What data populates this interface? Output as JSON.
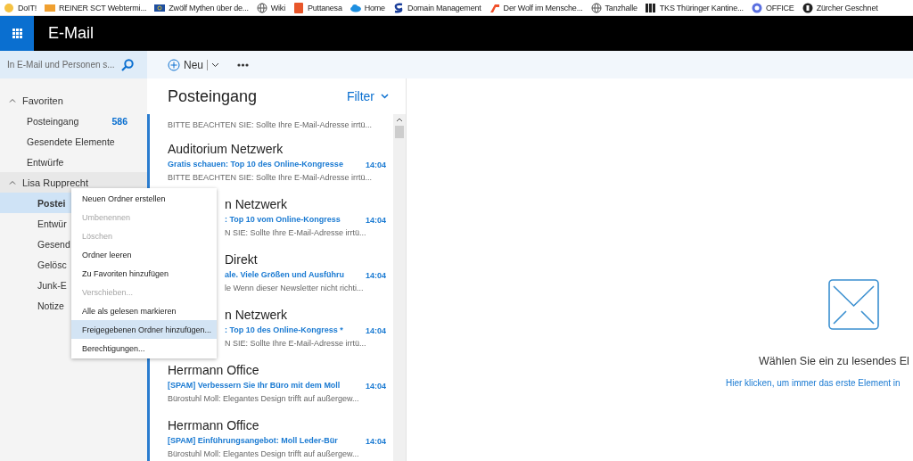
{
  "bookmarks": [
    {
      "label": "DoIT!"
    },
    {
      "label": "REINER SCT Webtermi..."
    },
    {
      "label": "Zwölf Mythen über de..."
    },
    {
      "label": "Wiki"
    },
    {
      "label": "Puttanesa"
    },
    {
      "label": "Home"
    },
    {
      "label": "Domain Management"
    },
    {
      "label": "Der Wolf im Mensche..."
    },
    {
      "label": "Tanzhalle"
    },
    {
      "label": "TKS Thüringer Kantine..."
    },
    {
      "label": "OFFICE"
    },
    {
      "label": "Zürcher Geschnet"
    }
  ],
  "app_bar": {
    "title": "E-Mail"
  },
  "search": {
    "placeholder": "In E-Mail und Personen s..."
  },
  "toolbar": {
    "new_label": "Neu"
  },
  "sidebar": {
    "groups": [
      {
        "label": "Favoriten",
        "expanded": true,
        "items": [
          {
            "label": "Posteingang",
            "count": "586",
            "selected": false
          },
          {
            "label": "Gesendete Elemente",
            "selected": false
          },
          {
            "label": "Entwürfe",
            "selected": false
          }
        ]
      },
      {
        "label": "Lisa Rupprecht",
        "expanded": true,
        "items": [
          {
            "label": "Postei",
            "selected": true
          },
          {
            "label": "Entwür",
            "selected": false
          },
          {
            "label": "Gesend",
            "selected": false
          },
          {
            "label": "Gelösc",
            "selected": false
          },
          {
            "label": "Junk-E",
            "selected": false
          },
          {
            "label": "Notize",
            "selected": false
          }
        ]
      }
    ]
  },
  "message_list": {
    "title": "Posteingang",
    "filter": "Filter",
    "messages": [
      {
        "kind": "partial",
        "unread": true,
        "preview": "BITTE BEACHTEN SIE: Sollte Ihre E-Mail-Adresse irrtü..."
      },
      {
        "kind": "full",
        "unread": true,
        "sender": "Auditorium Netzwerk",
        "subject": "Gratis schauen: Top 10 des Online-Kongresse",
        "time": "14:04",
        "preview": "BITTE BEACHTEN SIE: Sollte Ihre E-Mail-Adresse irrtü..."
      },
      {
        "kind": "covered",
        "unread": true,
        "sender": "n Netzwerk",
        "subject": ": Top 10 vom Online-Kongress",
        "time": "14:04",
        "preview": "N SIE: Sollte Ihre E-Mail-Adresse irrtü..."
      },
      {
        "kind": "covered",
        "unread": true,
        "sender": "Direkt",
        "subject": "ale. Viele Größen und Ausführu",
        "time": "14:04",
        "preview": "le Wenn dieser Newsletter nicht richti..."
      },
      {
        "kind": "covered",
        "unread": true,
        "sender": "n Netzwerk",
        "subject": ": Top 10 des Online-Kongress *",
        "time": "14:04",
        "preview": "N SIE: Sollte Ihre E-Mail-Adresse irrtü..."
      },
      {
        "kind": "full",
        "unread": true,
        "sender": "Herrmann Office",
        "subject": "[SPAM] Verbessern Sie Ihr Büro mit dem Moll",
        "time": "14:04",
        "preview": "Bürostuhl Moll: Elegantes Design trifft auf außergew..."
      },
      {
        "kind": "full",
        "unread": true,
        "sender": "Herrmann Office",
        "subject": "[SPAM] Einführungsangebot: Moll Leder-Bür",
        "time": "14:04",
        "preview": "Bürostuhl Moll: Elegantes Design trifft auf außergew..."
      }
    ]
  },
  "reading_pane": {
    "message": "Wählen Sie ein zu lesendes El",
    "link": "Hier klicken, um immer das erste Element in"
  },
  "context_menu": {
    "items": [
      {
        "label": "Neuen Ordner erstellen",
        "disabled": false,
        "highlighted": false
      },
      {
        "label": "Umbenennen",
        "disabled": true,
        "highlighted": false
      },
      {
        "label": "Löschen",
        "disabled": true,
        "highlighted": false
      },
      {
        "label": "Ordner leeren",
        "disabled": false,
        "highlighted": false
      },
      {
        "label": "Zu Favoriten hinzufügen",
        "disabled": false,
        "highlighted": false
      },
      {
        "label": "Verschieben...",
        "disabled": true,
        "highlighted": false
      },
      {
        "label": "Alle als gelesen markieren",
        "disabled": false,
        "highlighted": false
      },
      {
        "label": "Freigegebenen Ordner hinzufügen...",
        "disabled": false,
        "highlighted": true
      },
      {
        "label": "Berechtigungen...",
        "disabled": false,
        "highlighted": false
      }
    ]
  }
}
